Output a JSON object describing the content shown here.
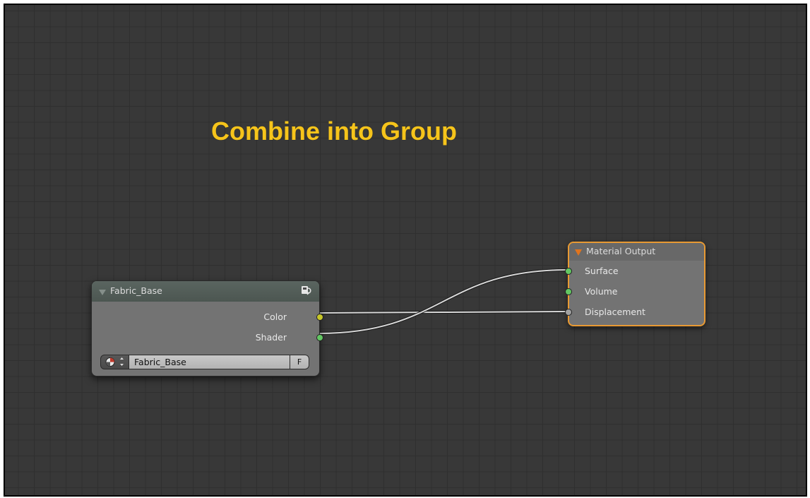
{
  "canvas": {
    "title": "Combine into Group"
  },
  "colors": {
    "background": "#383838",
    "grid": "#2f2f2f",
    "title": "#f6c41b",
    "group_header": "#4f5954",
    "output_border": "#e89a33",
    "socket_color": "#c7c729",
    "socket_shader": "#63c763",
    "socket_vector": "#a1a1a1"
  },
  "group_node": {
    "title": "Fabric_Base",
    "outputs": [
      {
        "label": "Color",
        "socket": "color"
      },
      {
        "label": "Shader",
        "socket": "shader"
      }
    ],
    "datablock": {
      "name": "Fabric_Base",
      "fake_user_label": "F"
    },
    "icon": "node-group-icon"
  },
  "output_node": {
    "title": "Material Output",
    "inputs": [
      {
        "label": "Surface",
        "socket": "shader"
      },
      {
        "label": "Volume",
        "socket": "shader"
      },
      {
        "label": "Displacement",
        "socket": "vector"
      }
    ]
  },
  "links": [
    {
      "from": "Fabric_Base.Color",
      "to": "Material Output.Displacement"
    },
    {
      "from": "Fabric_Base.Shader",
      "to": "Material Output.Surface"
    }
  ]
}
